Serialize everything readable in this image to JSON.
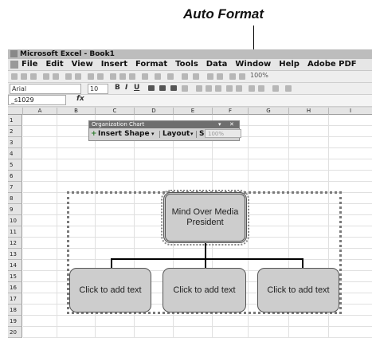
{
  "callout": {
    "label": "Auto Format"
  },
  "window": {
    "title": "Microsoft Excel - Book1"
  },
  "menu": [
    "File",
    "Edit",
    "View",
    "Insert",
    "Format",
    "Tools",
    "Data",
    "Window",
    "Help",
    "Adobe PDF"
  ],
  "formatting": {
    "font": "Arial",
    "size": "10",
    "bold": "B",
    "italic": "I",
    "underline": "U",
    "zoom": "100%"
  },
  "formula_bar": {
    "name_box": "_s1029",
    "fx": "fx"
  },
  "columns": [
    "A",
    "B",
    "C",
    "D",
    "E",
    "F",
    "G",
    "H",
    "I"
  ],
  "rows": [
    "1",
    "2",
    "3",
    "4",
    "5",
    "6",
    "7",
    "8",
    "9",
    "10",
    "11",
    "12",
    "13",
    "14",
    "15",
    "16",
    "17",
    "18",
    "19",
    "20"
  ],
  "org_toolbar": {
    "title": "Organization Chart",
    "insert_shape": "Insert Shape",
    "layout": "Layout",
    "select": "Select",
    "zoom": "100%"
  },
  "org_chart": {
    "top": {
      "line1": "Mind Over Media",
      "line2": "President"
    },
    "children": [
      "Click to add text",
      "Click to add text",
      "Click to add text"
    ]
  }
}
